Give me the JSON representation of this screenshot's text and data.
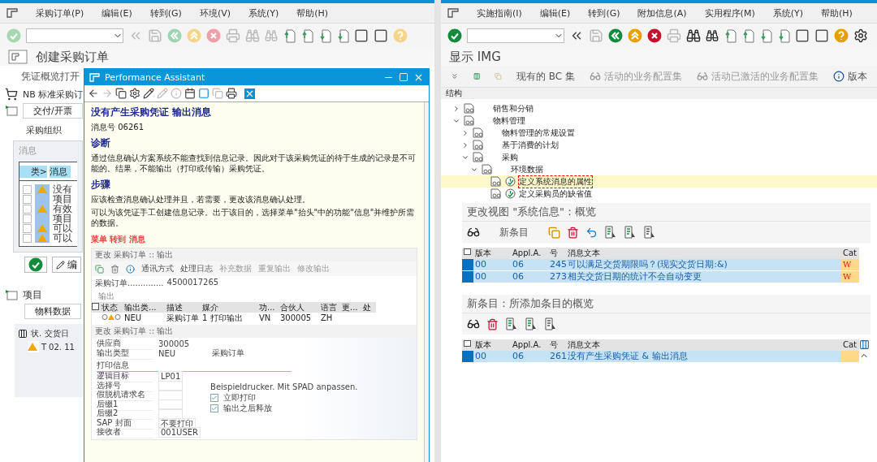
{
  "left": {
    "menu": [
      "采购订单(P)",
      "编辑(E)",
      "转到(G)",
      "环境(V)",
      "系统(Y)",
      "帮助(H)"
    ],
    "title": "创建采购订单",
    "app_toolbar": [
      "凭证概览打开"
    ],
    "doc_type": "NB 标准采购订",
    "header_tab": "交付/开票",
    "org_label": "采购组织",
    "messages": {
      "title": "消息",
      "columns": [
        "类>",
        "消息"
      ],
      "rows": [
        {
          "text": "没有",
          "warning": true,
          "checked": false
        },
        {
          "text": "项目",
          "warning": false,
          "checked": false
        },
        {
          "text": "有效",
          "warning": true,
          "checked": false
        },
        {
          "text": "项目",
          "warning": false,
          "checked": false
        },
        {
          "text": "可以",
          "warning": true,
          "checked": false
        },
        {
          "text": "可以",
          "warning": true,
          "checked": false
        }
      ]
    },
    "edit_button": "编",
    "items": {
      "title": "项目",
      "tab": "物料数据",
      "columns": [
        "状.",
        "交货日"
      ],
      "rows": [
        {
          "warning": true,
          "category": "T",
          "date": "02. 11"
        }
      ]
    }
  },
  "assistant": {
    "title": "Performance Assistant",
    "heading": "没有产生采购凭证 输出消息",
    "message_no": "消息号 06261",
    "sections": [
      {
        "heading": "诊断",
        "paragraphs": [
          "通过信息确认方案系统不能查找到信息记录。因此对于该采购凭证的待于生成的记录是不可能的。结果，不能输出（打印或传输）采购凭证。"
        ]
      },
      {
        "heading": "步骤",
        "paragraphs": [
          "应该检查消息确认处理并且，若需要，更改该消息确认处理。",
          "可以为该凭证手工创建信息记录。出于该目的，选择菜单\"抬头\"中的功能\"信息\"并维护所需的数据。"
        ]
      }
    ],
    "link": "菜单 转到 消息",
    "embedded": {
      "title": "更改 采购订单 :: 输出",
      "toolbar": [
        {
          "label": "通讯方式",
          "disabled": false
        },
        {
          "label": "处理日志",
          "disabled": false
        },
        {
          "label": "补充数据",
          "disabled": true
        },
        {
          "label": "重复输出",
          "disabled": true
        },
        {
          "label": "修改输出",
          "disabled": true
        }
      ],
      "doc_label": "采购订单..............",
      "doc_no": "4500017265",
      "group": "输出",
      "columns": [
        "状态",
        "输出类...",
        "描述",
        "媒介",
        "功...",
        "合伙人",
        "语言",
        "更...",
        "处"
      ],
      "row": {
        "type": "NEU",
        "desc": "采购订单",
        "medium": "1  打印输出",
        "function": "VN",
        "partner": "300005",
        "lang": "ZH"
      },
      "title2": "更改 采购订单 :: 输出",
      "fields": [
        {
          "label": "供应商",
          "value": "300005"
        },
        {
          "label": "输出类型",
          "value": "NEU",
          "extra": "采购订单"
        }
      ],
      "print_group": "打印信息",
      "print_fields": [
        {
          "label": "逻辑目标",
          "value": "LP01"
        },
        {
          "label": "选择号"
        },
        {
          "label": "假脱机请求名"
        },
        {
          "label": "后缀1"
        },
        {
          "label": "后缀2"
        },
        {
          "label": "SAP 封面",
          "value": "不要打印"
        },
        {
          "label": "接收者",
          "value": "001USER"
        }
      ],
      "printer_note": "Beispieldrucker. Mit SPAD anpassen.",
      "checks": [
        {
          "label": "立即打印",
          "checked": true
        },
        {
          "label": "输出之后释放",
          "checked": true
        }
      ]
    }
  },
  "right": {
    "menu": [
      "实施指南(I)",
      "编辑(E)",
      "转到(G)",
      "附加信息(A)",
      "实用程序(M)",
      "系统(Y)",
      "帮助(H)"
    ],
    "title": "显示 IMG",
    "app_toolbar": [
      {
        "label": "现有的 BC 集",
        "kind": "plain",
        "disabled": false
      },
      {
        "label": "活动的业务配置集",
        "kind": "glasses",
        "disabled": true
      },
      {
        "label": "活动已激活的业务配置集",
        "kind": "glasses",
        "disabled": true
      },
      {
        "label": "版本",
        "kind": "info",
        "disabled": false
      }
    ],
    "tree_header": "结构",
    "tree": [
      {
        "label": "销售和分销",
        "kind": "folder",
        "expanded": false
      },
      {
        "label": "物料管理",
        "kind": "folder",
        "expanded": true,
        "children": [
          {
            "label": "物料管理的常规设置",
            "kind": "folder",
            "expanded": false
          },
          {
            "label": "基于消费的计划",
            "kind": "folder",
            "expanded": false
          },
          {
            "label": "采购",
            "kind": "folder",
            "expanded": true,
            "children": [
              {
                "label": "环境数据",
                "kind": "folder",
                "expanded": true,
                "children": [
                  {
                    "label": "定义系统消息的属性",
                    "kind": "activity",
                    "selected": true
                  },
                  {
                    "label": "定义采购员的缺省值",
                    "kind": "activity",
                    "selected": false
                  }
                ]
              }
            ]
          }
        ]
      }
    ],
    "view": {
      "title": "更改视图 \"系统信息\"：概览",
      "toolbar_label": "新条目",
      "columns": [
        "版本",
        "Appl.A.",
        "号",
        "消息文本",
        "Cat"
      ],
      "rows": [
        {
          "version": "00",
          "area": "06",
          "number": "245",
          "text": "可以满足交货期限吗？(现实交货日期:&)",
          "cat": "W",
          "selected": true
        },
        {
          "version": "00",
          "area": "06",
          "number": "273",
          "text": "相关交货日期的统计不会自动变更",
          "cat": "W",
          "selected": true
        }
      ]
    },
    "new_entries": {
      "title": "新条目：所添加条目的概览",
      "columns": [
        "版本",
        "Appl.A.",
        "号",
        "消息文本",
        "Cat"
      ],
      "rows": [
        {
          "version": "00",
          "area": "06",
          "number": "261",
          "text": "没有产生采购凭证 & 输出消息",
          "selected": true
        }
      ]
    }
  }
}
